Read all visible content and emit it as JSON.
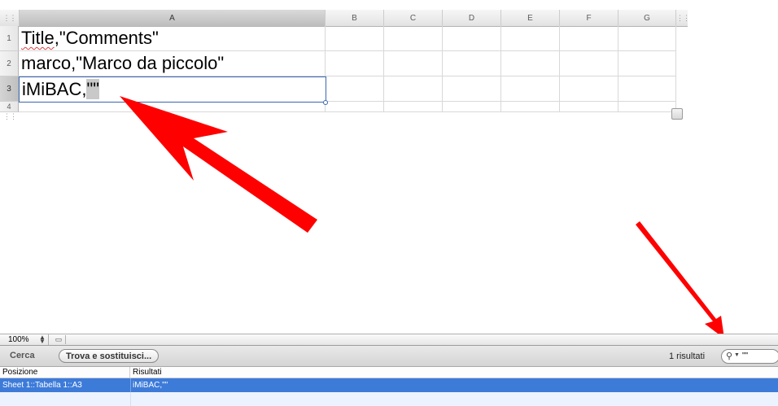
{
  "sheet": {
    "columns": [
      "A",
      "B",
      "C",
      "D",
      "E",
      "F",
      "G"
    ],
    "row_numbers": [
      "1",
      "2",
      "3",
      "4"
    ],
    "cells": {
      "a1_word": "Title",
      "a1_rest": ",\"Comments\"",
      "a2": "marco,\"Marco da piccolo\"",
      "a3_text": "iMiBAC,",
      "a3_quotes": "\"\""
    }
  },
  "zoom": {
    "value": "100%"
  },
  "find": {
    "tab_label": "Cerca",
    "replace_button": "Trova e sostituisci...",
    "results_count": "1 risultati",
    "search_value": "\"\""
  },
  "results_table": {
    "headers": [
      "Posizione",
      "Risultati"
    ],
    "rows": [
      {
        "position": "Sheet 1::Tabella 1::A3",
        "result": "iMiBAC,\"\""
      }
    ]
  },
  "colors": {
    "selection_blue": "#3d7bd9",
    "arrow_red": "#ff0000",
    "active_cell_border": "#3a67b1"
  }
}
